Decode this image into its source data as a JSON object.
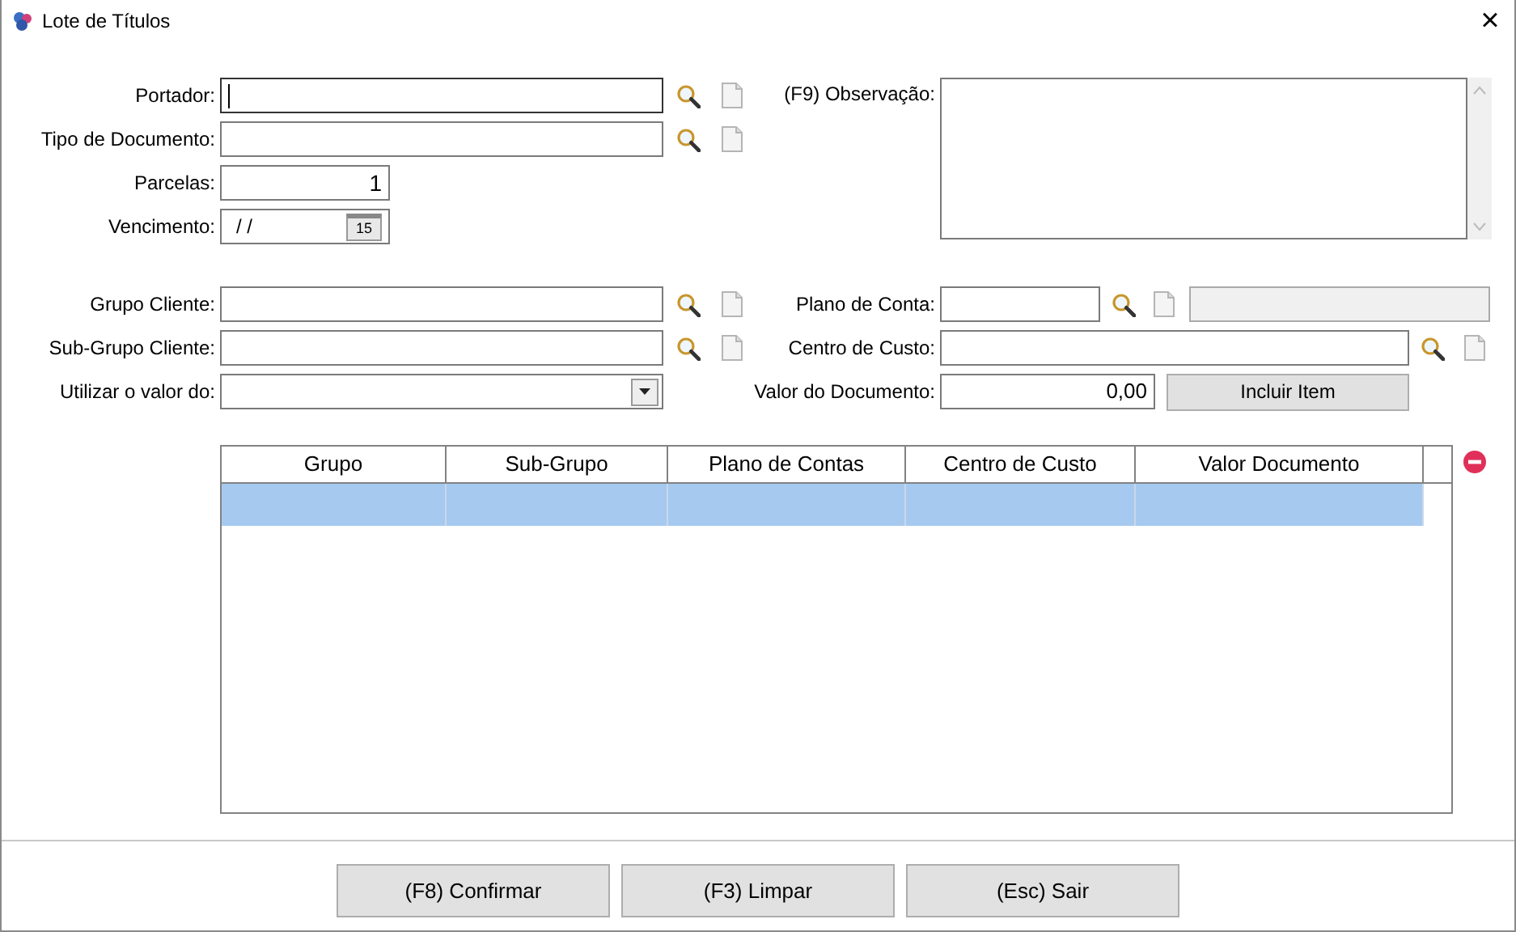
{
  "window": {
    "title": "Lote de Títulos",
    "close": "×"
  },
  "header_left": [
    {
      "label": "Portador:",
      "kind": "lookup",
      "focused": true
    },
    {
      "label": "Tipo de Documento:",
      "kind": "lookup",
      "focused": false
    },
    {
      "label": "Parcelas:",
      "kind": "number",
      "value": "1",
      "focused": false
    },
    {
      "label": "Vencimento:",
      "kind": "date",
      "value": "/  /",
      "calendar": "15",
      "focused": false
    }
  ],
  "observation": {
    "label": "(F9) Observação:"
  },
  "filter_left": [
    {
      "label": "Grupo Cliente:",
      "kind": "lookup"
    },
    {
      "label": "Sub-Grupo Cliente:",
      "kind": "lookup"
    },
    {
      "label": "Utilizar o valor do:",
      "kind": "select"
    }
  ],
  "filter_right": [
    {
      "label": "Plano de Conta:",
      "kind": "account"
    },
    {
      "label": "Centro de Custo:",
      "kind": "lookup"
    },
    {
      "label": "Valor do Documento:",
      "kind": "amount",
      "value": "0,00",
      "button": "Incluir Item"
    }
  ],
  "table": {
    "columns": [
      "Grupo",
      "Sub-Grupo",
      "Plano de Contas",
      "Centro de Custo",
      "Valor Documento"
    ],
    "rows": [
      {
        "selected": true
      }
    ]
  },
  "buttons": [
    "(F8) Confirmar",
    "(F3) Limpar",
    "(Esc) Sair"
  ]
}
